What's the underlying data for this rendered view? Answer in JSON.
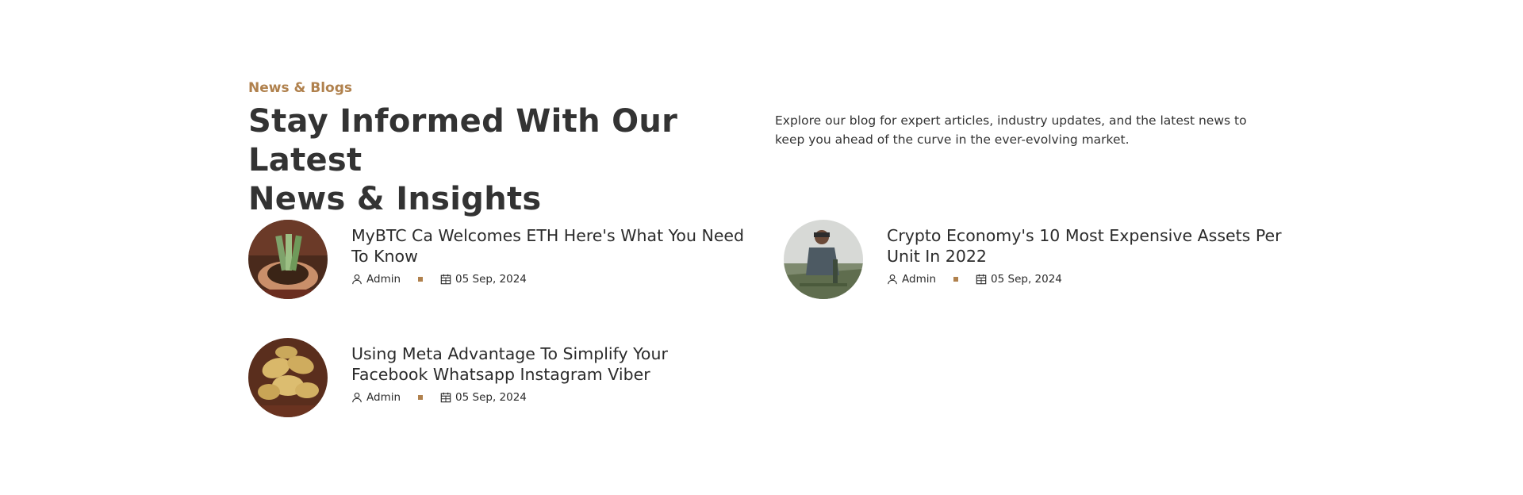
{
  "section": {
    "subtitle": "News & Blogs",
    "title_line1": "Stay Informed With Our Latest",
    "title_line2": "News & Insights",
    "description": "Explore our blog for expert articles, industry updates, and the latest news to keep you ahead of the curve in the ever-evolving market."
  },
  "posts": [
    {
      "title": "MyBTC Ca Welcomes ETH Here's What You Need To Know",
      "author": "Admin",
      "date": "05 Sep, 2024",
      "author_icon": "user-icon",
      "date_icon": "calendar-icon"
    },
    {
      "title": "Crypto Economy's 10 Most Expensive Assets Per Unit In 2022",
      "author": "Admin",
      "date": "05 Sep, 2024",
      "author_icon": "user-icon",
      "date_icon": "calendar-icon"
    },
    {
      "title": "Using Meta Advantage To Simplify Your Facebook Whatsapp Instagram Viber",
      "author": "Admin",
      "date": "05 Sep, 2024",
      "author_icon": "user-icon",
      "date_icon": "calendar-icon"
    }
  ],
  "colors": {
    "accent": "#b0814d",
    "heading": "#333333",
    "background": "#ffffff"
  }
}
